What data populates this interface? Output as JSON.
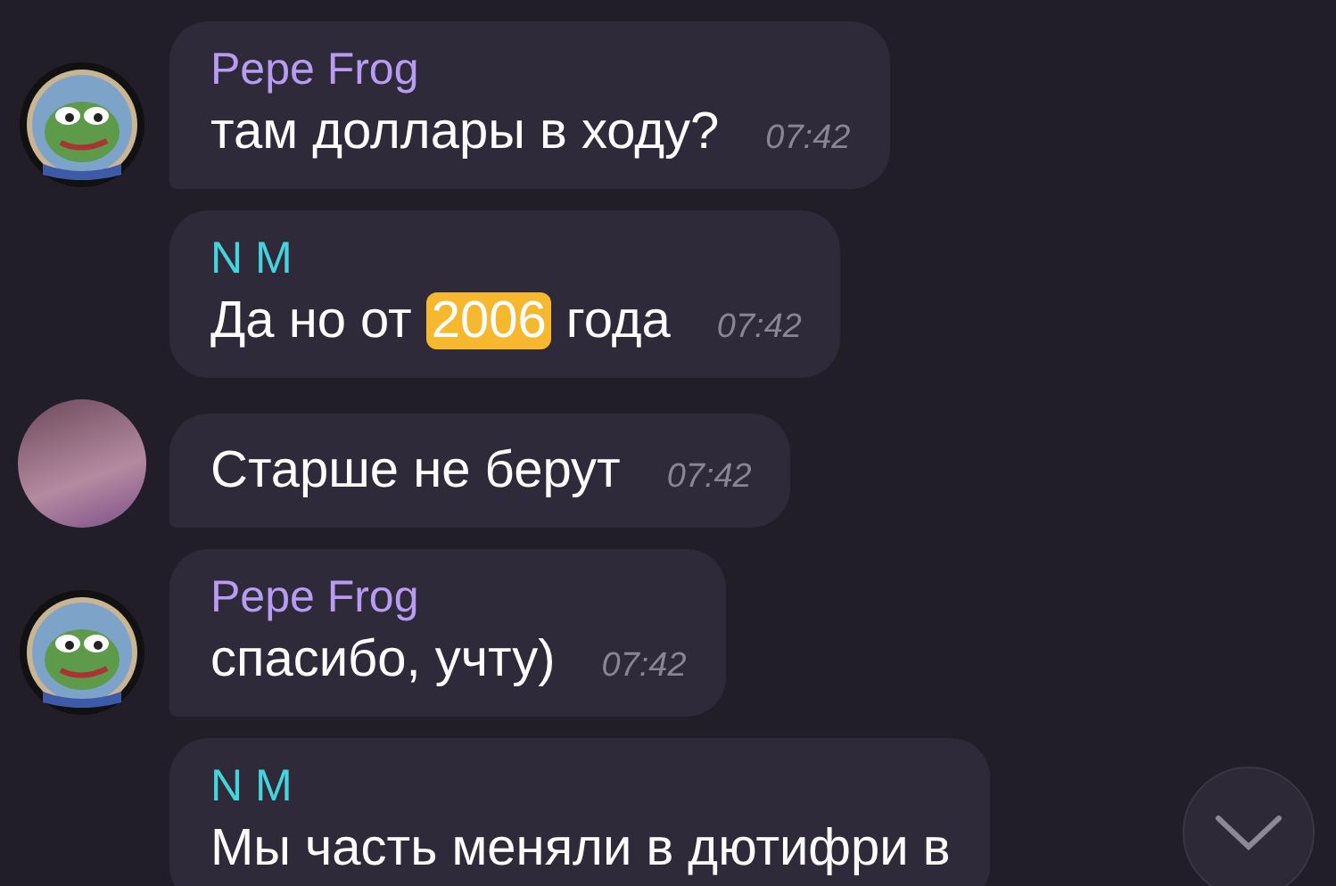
{
  "messages": [
    {
      "sender": "Pepe Frog",
      "color": "#b79cf2",
      "kind": "frog",
      "parts": [
        {
          "text": "там доллары в ходу?",
          "highlighted": false
        }
      ],
      "time": "07:42"
    },
    {
      "sender": "N M",
      "color": "#45d3de",
      "kind": "plain",
      "parts": [
        {
          "text": "Да но от ",
          "highlighted": false
        },
        {
          "text": "2006",
          "highlighted": true
        },
        {
          "text": " года",
          "highlighted": false
        }
      ],
      "time": "07:42"
    },
    {
      "kind": "photo",
      "parts": [
        {
          "text": "Старше не берут",
          "highlighted": false
        }
      ],
      "time": "07:42"
    },
    {
      "sender": "Pepe Frog",
      "color": "#b79cf2",
      "kind": "frog",
      "parts": [
        {
          "text": "спасибо, учту)",
          "highlighted": false
        }
      ],
      "time": "07:42"
    },
    {
      "sender": "N M",
      "color": "#45d3de",
      "kind": "plain",
      "parts": [
        {
          "text": "Мы часть меняли в дютифри в",
          "highlighted": false
        }
      ]
    }
  ]
}
